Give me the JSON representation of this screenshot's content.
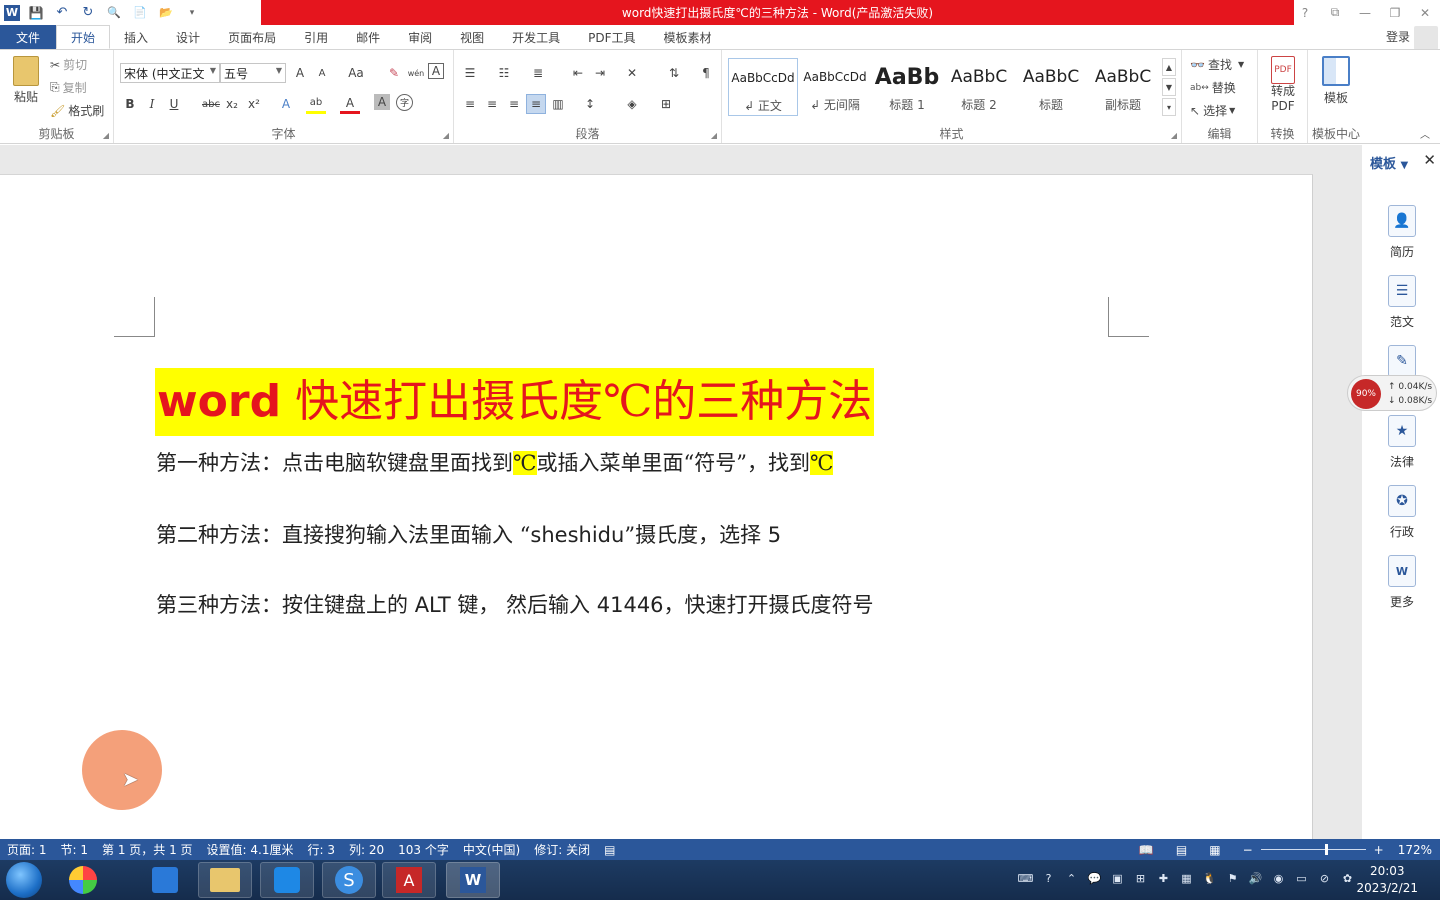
{
  "window": {
    "title": "word快速打出摄氏度℃的三种方法 - Word(产品激活失败)",
    "help": "?",
    "restore_ribbon": "⧉",
    "minimize": "—",
    "maximize": "❐",
    "close": "✕"
  },
  "quick_access": {
    "word_icon": "W",
    "save": "💾",
    "undo": "↶",
    "redo": "↻",
    "print_preview": "🔍",
    "new": "📄",
    "open": "📂",
    "more": "▾"
  },
  "tabs": [
    "文件",
    "开始",
    "插入",
    "设计",
    "页面布局",
    "引用",
    "邮件",
    "审阅",
    "视图",
    "开发工具",
    "PDF工具",
    "模板素材"
  ],
  "login": "登录",
  "clipboard": {
    "paste": "粘贴",
    "cut": "剪切",
    "copy": "复制",
    "format_painter": "格式刷",
    "label": "剪贴板"
  },
  "font": {
    "name": "宋体 (中文正文",
    "size": "五号",
    "grow": "A",
    "shrink": "A",
    "case": "Aa",
    "clear": "✎",
    "phonetic": "wén",
    "border": "A",
    "bold": "B",
    "italic": "I",
    "underline": "U",
    "strike": "abc",
    "subscript": "x₂",
    "superscript": "x²",
    "effects": "A",
    "highlight": "ab",
    "color": "A",
    "shading": "A",
    "enclose": "字",
    "label": "字体"
  },
  "paragraph": {
    "label": "段落"
  },
  "styles": {
    "items": [
      {
        "preview": "AaBbCcDd",
        "label": "↲ 正文"
      },
      {
        "preview": "AaBbCcDd",
        "label": "↲ 无间隔"
      },
      {
        "preview": "AaBb",
        "label": "标题 1"
      },
      {
        "preview": "AaBbC",
        "label": "标题 2"
      },
      {
        "preview": "AaBbC",
        "label": "标题"
      },
      {
        "preview": "AaBbC",
        "label": "副标题"
      }
    ],
    "label": "样式"
  },
  "editing": {
    "find": "查找",
    "replace": "替换",
    "select": "选择",
    "label": "编辑"
  },
  "convert": {
    "to_pdf_line1": "转成",
    "to_pdf_line2": "PDF",
    "label": "转换"
  },
  "template_center": {
    "button": "模板",
    "label": "模板中心"
  },
  "document": {
    "title_latin": "word",
    "title_rest": " 快速打出摄氏度℃的三种方法",
    "p1_a": "第一种方法：点击电脑软键盘里面找到",
    "p1_c1": "℃",
    "p1_b": "或插入菜单里面“符号”，找到",
    "p1_c2": "℃",
    "p2_a": "第二种方法：直接搜狗输入法里面输入 “",
    "p2_code": "sheshidu",
    "p2_b": "”摄氏度，选择 ",
    "p2_num": "5",
    "p3_a": "第三种方法：按住键盘上的 ",
    "p3_alt": "ALT",
    "p3_b": " 键， 然后输入 ",
    "p3_num": "41446",
    "p3_c": "，快速打开摄氏度符号"
  },
  "template_pane": {
    "title": "模板",
    "items": [
      "简历",
      "范文",
      "法律",
      "行政",
      "更多"
    ]
  },
  "net_monitor": {
    "percent": "90%",
    "up": "↑ 0.04K/s",
    "down": "↓ 0.08K/s"
  },
  "status_bar": {
    "page": "页面: 1",
    "section": "节: 1",
    "page_of": "第 1 页，共 1 页",
    "setting": "设置值: 4.1厘米",
    "line": "行: 3",
    "col": "列: 20",
    "words": "103 个字",
    "lang": "中文(中国)",
    "track": "修订: 关闭",
    "zoom": "172%"
  },
  "taskbar": {
    "time": "20:03",
    "date": "2023/2/21"
  }
}
